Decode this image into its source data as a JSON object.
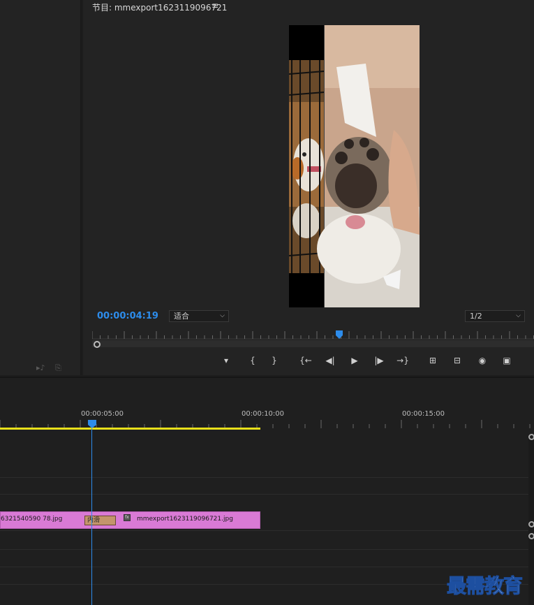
{
  "program_monitor": {
    "title": "节目: mmexport1623119096721",
    "menu_glyph": "≡",
    "timecode": "00:00:04:19",
    "fit_dropdown": "适合",
    "resolution_dropdown": "1/2",
    "playhead_fraction": 0.56
  },
  "controls": [
    {
      "name": "add-marker-button",
      "glyph": "▼"
    },
    {
      "name": "mark-in-button",
      "glyph": "{"
    },
    {
      "name": "mark-out-button",
      "glyph": "}"
    },
    {
      "name": "go-to-in-button",
      "glyph": "{←"
    },
    {
      "name": "step-back-button",
      "glyph": "◀|"
    },
    {
      "name": "play-button",
      "glyph": "▶"
    },
    {
      "name": "step-forward-button",
      "glyph": "|▶"
    },
    {
      "name": "go-to-out-button",
      "glyph": "→}"
    },
    {
      "name": "lift-button",
      "glyph": "⏏"
    },
    {
      "name": "extract-button",
      "glyph": "⏏"
    },
    {
      "name": "export-frame-button",
      "glyph": "📷"
    },
    {
      "name": "comparison-view-button",
      "glyph": "▣"
    }
  ],
  "timeline": {
    "time_labels": [
      "00:00:05:00",
      "00:00:10:00",
      "00:00:15:00"
    ],
    "clip_left_name": "6321540590 78.jpg",
    "clip_right_name": "mmexport1623119096721.jpg",
    "transition_label": "内滑",
    "fx_badge": "fx"
  },
  "watermark": "最需教育",
  "colors": {
    "accent": "#2d8ceb",
    "clip": "#d97ad5",
    "work_area": "#e8e01a",
    "transition": "#c4956c"
  }
}
